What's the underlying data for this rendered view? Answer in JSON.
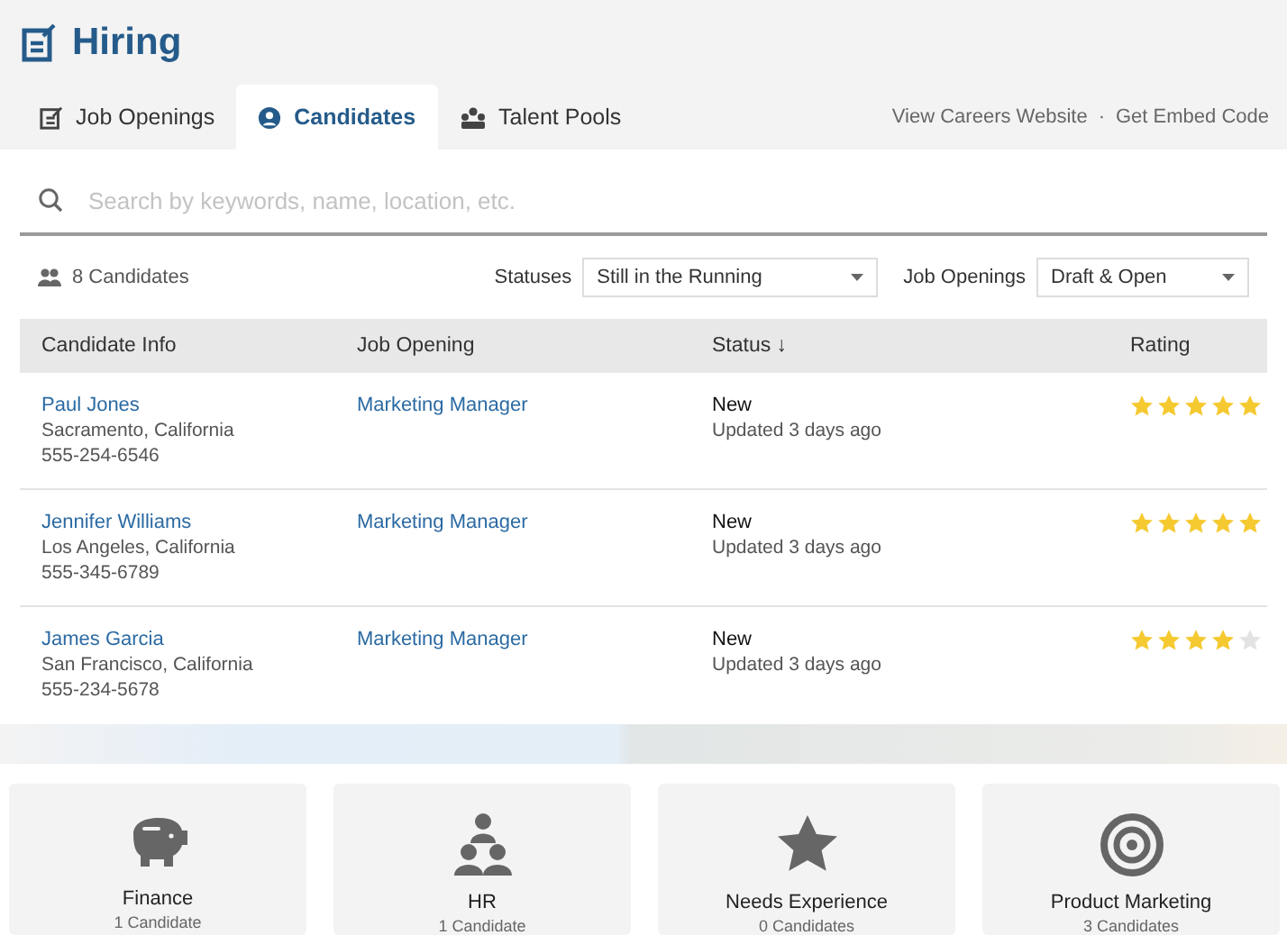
{
  "header": {
    "title": "Hiring"
  },
  "tabs": [
    {
      "label": "Job Openings",
      "selected": false
    },
    {
      "label": "Candidates",
      "selected": true
    },
    {
      "label": "Talent Pools",
      "selected": false
    }
  ],
  "links": [
    "View Careers Website",
    "Get Embed Code"
  ],
  "link_separator": "·",
  "search": {
    "placeholder": "Search by keywords, name, location, etc."
  },
  "count": "8 Candidates",
  "filters": [
    {
      "label": "Statuses",
      "value": "Still in the Running"
    },
    {
      "label": "Job Openings",
      "value": "Draft & Open"
    }
  ],
  "table": {
    "columns": [
      "Candidate Info",
      "Job Opening",
      "Status ↓",
      "Rating"
    ],
    "rows": [
      {
        "name": "Paul Jones",
        "location": "Sacramento, California",
        "phone": "555-254-6546",
        "job": "Marketing Manager",
        "status": "New",
        "updated": "Updated 3 days ago",
        "stars": 5
      },
      {
        "name": "Jennifer Williams",
        "location": "Los Angeles, California",
        "phone": "555-345-6789",
        "job": "Marketing Manager",
        "status": "New",
        "updated": "Updated 3 days ago",
        "stars": 5
      },
      {
        "name": "James Garcia",
        "location": "San Francisco, California",
        "phone": "555-234-5678",
        "job": "Marketing Manager",
        "status": "New",
        "updated": "Updated 3 days ago",
        "stars": 4
      }
    ]
  },
  "pools": [
    {
      "name": "Finance",
      "count": "1 Candidate"
    },
    {
      "name": "HR",
      "count": "1 Candidate"
    },
    {
      "name": "Needs Experience",
      "count": "0 Candidates"
    },
    {
      "name": "Product Marketing",
      "count": "3 Candidates"
    }
  ]
}
